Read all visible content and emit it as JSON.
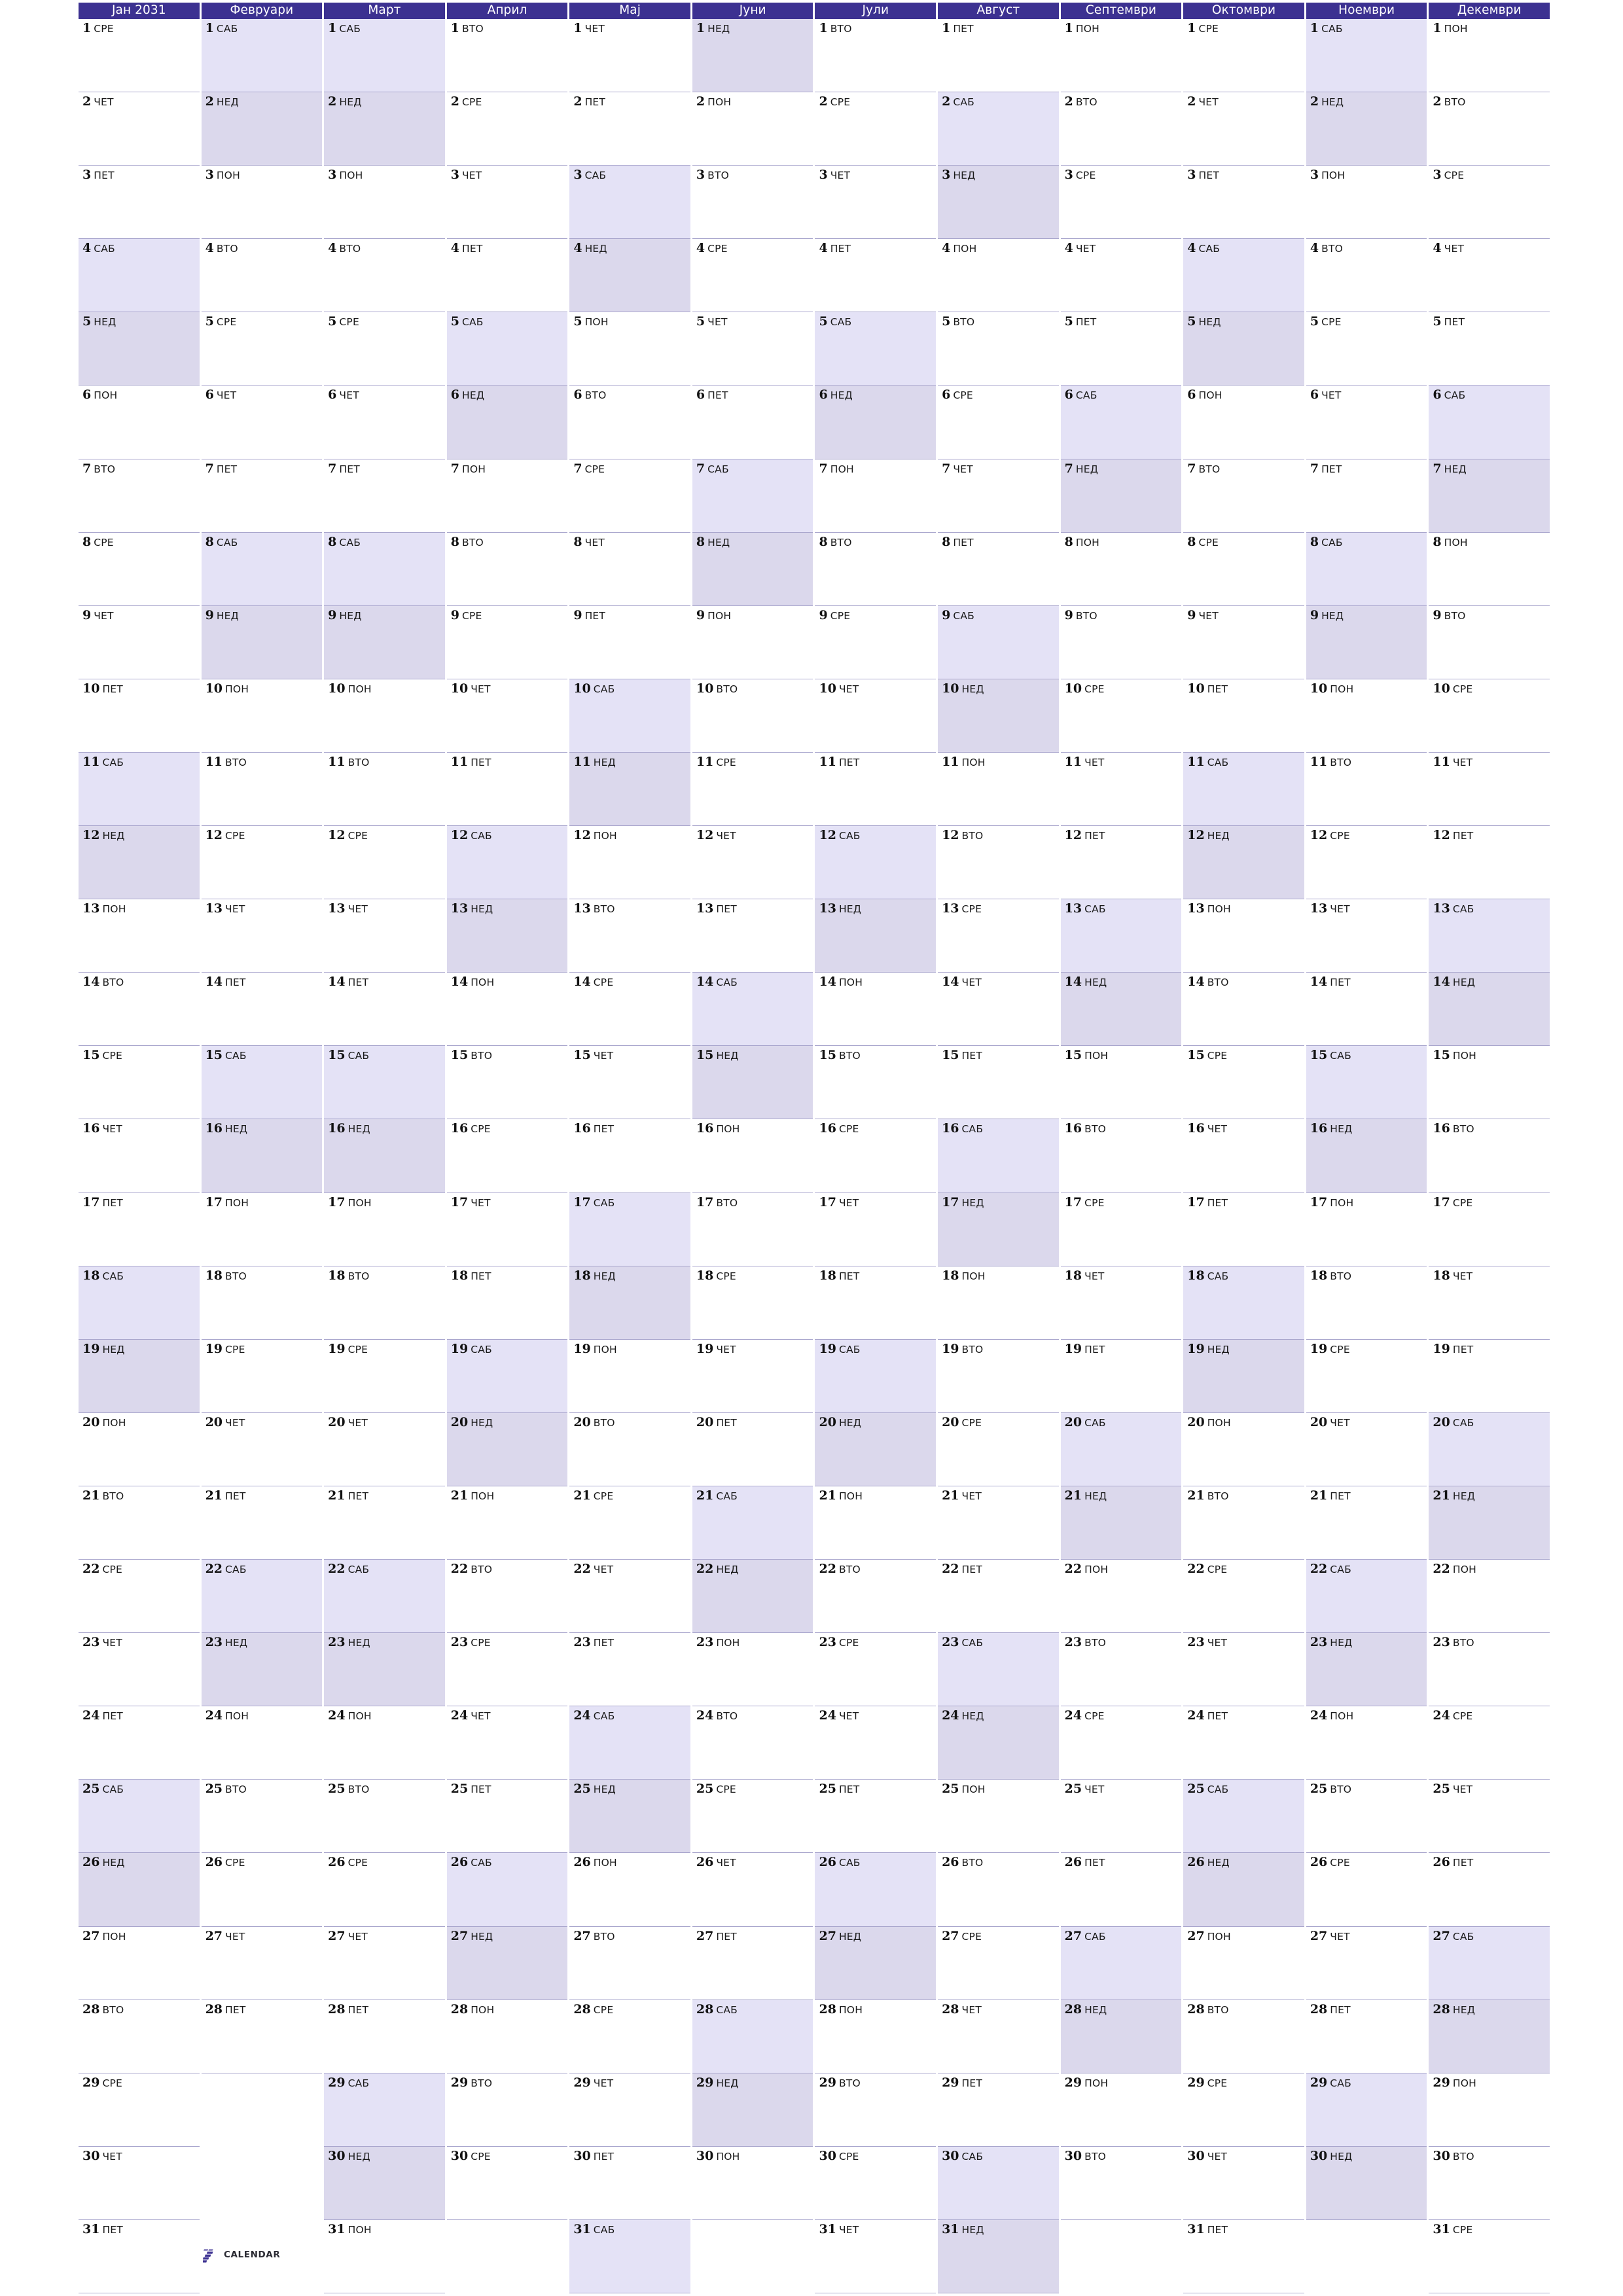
{
  "document": {
    "kind": "yearly-planner-calendar",
    "year": 2031,
    "locale_label": "mk",
    "rows": 31,
    "columns": 12
  },
  "colors": {
    "header_bg": "#3c3191",
    "header_text": "#ffffff",
    "saturday_bg": "#e4e2f6",
    "sunday_bg": "#dbd8ec",
    "cell_border": "#a9a6cd",
    "page_bg": "#ffffff",
    "day_text": "#111111",
    "brand_text": "#2b2b33",
    "brand_mark": "#3c3191"
  },
  "months": [
    {
      "index": 1,
      "label": "Јан 2031",
      "days": 31,
      "first_weekday": 3
    },
    {
      "index": 2,
      "label": "Февруари",
      "days": 28,
      "first_weekday": 6
    },
    {
      "index": 3,
      "label": "Март",
      "days": 31,
      "first_weekday": 6
    },
    {
      "index": 4,
      "label": "Април",
      "days": 30,
      "first_weekday": 2
    },
    {
      "index": 5,
      "label": "Мај",
      "days": 31,
      "first_weekday": 4
    },
    {
      "index": 6,
      "label": "Јуни",
      "days": 30,
      "first_weekday": 7
    },
    {
      "index": 7,
      "label": "Јули",
      "days": 31,
      "first_weekday": 2
    },
    {
      "index": 8,
      "label": "Август",
      "days": 31,
      "first_weekday": 5
    },
    {
      "index": 9,
      "label": "Септември",
      "days": 30,
      "first_weekday": 1
    },
    {
      "index": 10,
      "label": "Октомври",
      "days": 31,
      "first_weekday": 3
    },
    {
      "index": 11,
      "label": "Ноември",
      "days": 30,
      "first_weekday": 6
    },
    {
      "index": 12,
      "label": "Декември",
      "days": 31,
      "first_weekday": 1
    }
  ],
  "weekday_abbr": {
    "1": "ПОН",
    "2": "ВТО",
    "3": "СРЕ",
    "4": "ЧЕТ",
    "5": "ПЕТ",
    "6": "САБ",
    "7": "НЕД"
  },
  "weekend": {
    "saturday": 6,
    "sunday": 7
  },
  "brand": {
    "mark_digit": "7",
    "text": "CALENDAR"
  }
}
